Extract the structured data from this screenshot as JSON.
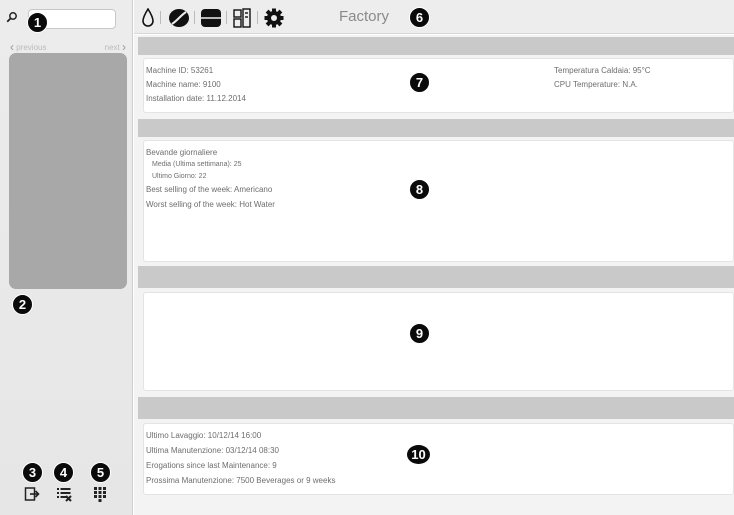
{
  "sidebar": {
    "search": {
      "placeholder": "",
      "value": ""
    },
    "pager": {
      "previous_label": "previous",
      "next_label": "next"
    },
    "tools": [
      {
        "icon": "logout-icon"
      },
      {
        "icon": "list-edit-icon"
      },
      {
        "icon": "keypad-icon"
      }
    ]
  },
  "toolbar": {
    "icons": [
      "water-drop-icon",
      "coffee-bean-icon",
      "boiler-icon",
      "machine-icon",
      "gear-icon"
    ],
    "title": "Factory"
  },
  "machine_info": {
    "machine_id": "Machine ID: 53261",
    "machine_name": "Machine name: 9100",
    "installation_date": "Installation date: 11.12.2014",
    "boiler_temperature": "Temperatura Caldaia: 95°C",
    "cpu_temperature": "CPU Temperature: N.A."
  },
  "beverages": {
    "heading": "Bevande giornaliere",
    "weekly_average": "Media (Ultima settimana): 25",
    "last_day": "Ultimo Giorno: 22",
    "best_selling": "Best selling of the week: Americano",
    "worst_selling": "Worst selling of the week: Hot Water"
  },
  "maintenance": {
    "last_wash": "Ultimo Lavaggio: 10/12/14 16:00",
    "last_maintenance": "Ultima Manutenzione: 03/12/14 08:30",
    "erogations": "Erogations since last Maintenance: 9",
    "next_maintenance": "Prossima Manutenzione: 7500 Beverages or 9 weeks"
  },
  "badges": [
    "1",
    "2",
    "3",
    "4",
    "5",
    "6",
    "7",
    "8",
    "9",
    "10"
  ]
}
